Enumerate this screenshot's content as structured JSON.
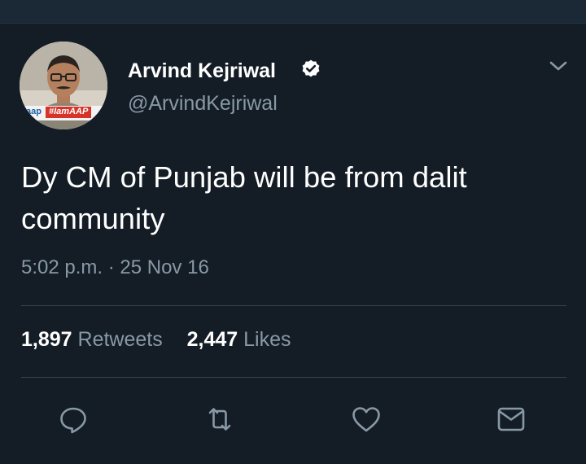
{
  "tweet": {
    "author": {
      "display_name": "Arvind Kejriwal",
      "handle": "@ArvindKejriwal",
      "verified": true
    },
    "avatar": {
      "badge_text": "#IamAAP",
      "logo_text": "aap"
    },
    "text": "Dy CM of Punjab will be from dalit community",
    "timestamp": "5:02 p.m. · 25 Nov 16",
    "stats": {
      "retweets_count": "1,897",
      "retweets_label": "Retweets",
      "likes_count": "2,447",
      "likes_label": "Likes"
    },
    "actions": [
      {
        "icon": "reply-icon"
      },
      {
        "icon": "retweet-icon"
      },
      {
        "icon": "like-icon"
      },
      {
        "icon": "direct-message-icon"
      }
    ]
  },
  "colors": {
    "background": "#141d26",
    "primary_text": "#ffffff",
    "secondary_text": "#8899a6",
    "divider": "#38444d"
  }
}
